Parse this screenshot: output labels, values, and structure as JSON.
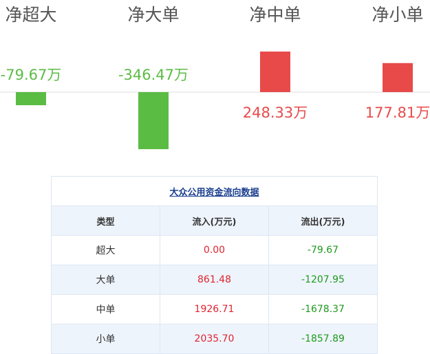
{
  "chart_data": {
    "type": "bar",
    "categories": [
      "净超大",
      "净大单",
      "净中单",
      "净小单"
    ],
    "values": [
      -79.67,
      -346.47,
      248.33,
      177.81
    ],
    "value_labels": [
      "-79.67万",
      "-346.47万",
      "248.33万",
      "177.81万"
    ],
    "ylim": [
      -346.47,
      248.33
    ],
    "grid": false,
    "colors": {
      "positive": "#e84a4a",
      "negative": "#5bbc44",
      "positive_label": "#e84a4a",
      "negative_label": "#5bbc44",
      "category_label": "#555555",
      "baseline": "#dddddd"
    }
  },
  "table": {
    "title": "大众公用资金流向数据",
    "headers": [
      "类型",
      "流入(万元)",
      "流出(万元)"
    ],
    "rows": [
      {
        "type": "超大",
        "inflow": "0.00",
        "outflow": "-79.67"
      },
      {
        "type": "大单",
        "inflow": "861.48",
        "outflow": "-1207.95"
      },
      {
        "type": "中单",
        "inflow": "1926.71",
        "outflow": "-1678.37"
      },
      {
        "type": "小单",
        "inflow": "2035.70",
        "outflow": "-1857.89"
      }
    ]
  }
}
